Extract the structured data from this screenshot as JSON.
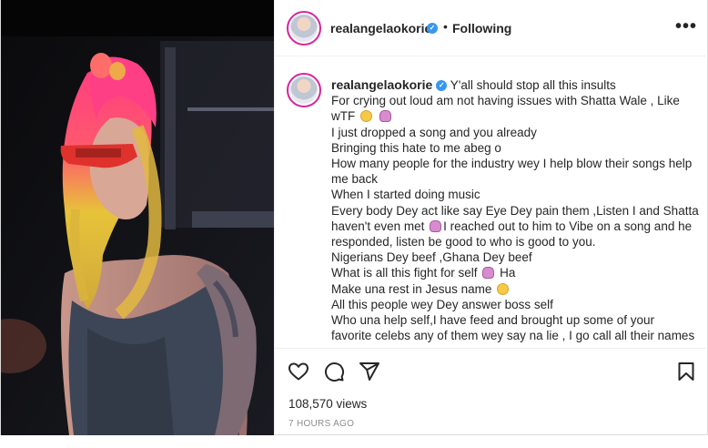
{
  "post": {
    "username": "realangelaokorie",
    "verified_mark": "✓",
    "separator": "•",
    "follow_status": "Following",
    "more_label": "•••",
    "caption_username": "realangelaokorie",
    "caption_lines": [
      "Y'all should stop all this insults",
      "For crying out loud am not having issues with Shatta Wale , Like",
      "wTF",
      "I just dropped a song and you already",
      "Bringing this hate to me abeg o",
      "How many people for the industry wey I help blow their songs help",
      "me back",
      "When I started doing music",
      "Every body Dey act like say Eye Dey pain them ,Listen I and Shatta",
      "haven't even met",
      "I reached out to him to Vibe on a song and he",
      "responded, listen be good to who is good to you.",
      "Nigerians Dey beef ,Ghana Dey beef",
      "What is all this fight for self",
      "Ha",
      "Make una rest in Jesus name",
      "All this people wey Dey answer boss self",
      "Who una help self,I have feed and brought up some of your",
      "favorite celebs any of them wey say na lie , I go call all their names"
    ],
    "views": "108,570 views",
    "timestamp": "7 HOURS AGO"
  },
  "icons": {
    "like": "heart-icon",
    "comment": "comment-icon",
    "share": "share-icon",
    "save": "bookmark-icon",
    "emoji_a": "worried-face-emoji",
    "emoji_b": "person-shrugging-emoji"
  },
  "colors": {
    "text": "#262626",
    "muted": "#8e8e8e",
    "verified": "#3897f0",
    "border": "#dbdbdb"
  }
}
